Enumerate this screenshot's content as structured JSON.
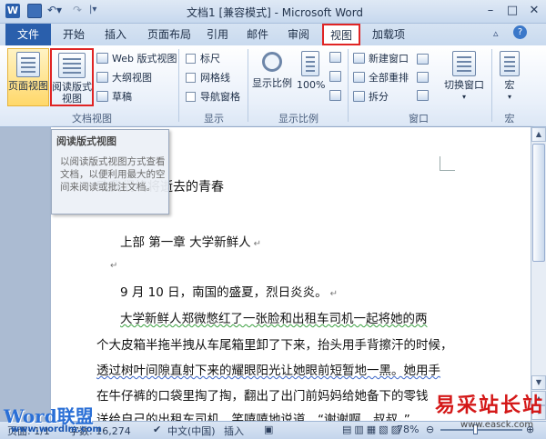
{
  "window": {
    "title": "文档1 [兼容模式] - Microsoft Word"
  },
  "tabs": {
    "file": "文件",
    "home": "开始",
    "insert": "插入",
    "page_layout": "页面布局",
    "references": "引用",
    "mailings": "邮件",
    "review": "审阅",
    "view": "视图",
    "addins": "加载项"
  },
  "ribbon": {
    "doc_views": {
      "group_label": "文档视图",
      "print_layout": "页面视图",
      "reading_line1": "阅读版式",
      "reading_line2": "视图",
      "web_layout": "Web 版式视图",
      "outline": "大纲视图",
      "draft": "草稿"
    },
    "show": {
      "group_label": "显示",
      "ruler": "标尺",
      "gridlines": "网格线",
      "nav_pane": "导航窗格"
    },
    "zoom": {
      "group_label": "显示比例",
      "zoom_btn": "显示比例",
      "hundred": "100%"
    },
    "window": {
      "group_label": "窗口",
      "new_window": "新建窗口",
      "arrange_all": "全部重排",
      "split": "拆分",
      "switch_windows": "切换窗口"
    },
    "macros": {
      "group_label": "宏",
      "macros_btn": "宏"
    }
  },
  "tooltip": {
    "title": "阅读版式视图",
    "body": "以阅读版式视图方式查看文档，以便利用最大的空间来阅读或批注文档。"
  },
  "document": {
    "heading": "致我们终将逝去的青春",
    "chapter": "上部  第一章  大学新鲜人",
    "p1": "9 月 10 日，南国的盛夏，烈日炎炎。",
    "p2_l1": "大学新鲜人郑微憋红了一张脸和出租车司机一起将她的两",
    "p2_l2": "个大皮箱半拖半拽从车尾箱里卸了下来，抬头用手背擦汗的时候，",
    "p2_l3": "透过树叶间隙直射下来的耀眼阳光让她眼前短暂地一黑。她用手",
    "p2_l4": "在牛仔裤的口袋里掏了掏，翻出了出门前妈妈给她备下的零钱",
    "p2_l5": "送给自己的出租车司机，笑嘻嘻地说道，“谢谢啊，叔叔。”"
  },
  "statusbar": {
    "page": "页面: 1/1",
    "words": "字数: 16,274",
    "lang": "中文(中国)",
    "insert": "插入",
    "zoom": "78%"
  },
  "watermarks": {
    "left_word": "Word联盟",
    "left_url": "www.wordlm.com",
    "right_cn": "易采站长站",
    "right_url": "www.easck.com"
  },
  "colors": {
    "accent": "#2a5fac",
    "highlight_box": "#e02424"
  }
}
